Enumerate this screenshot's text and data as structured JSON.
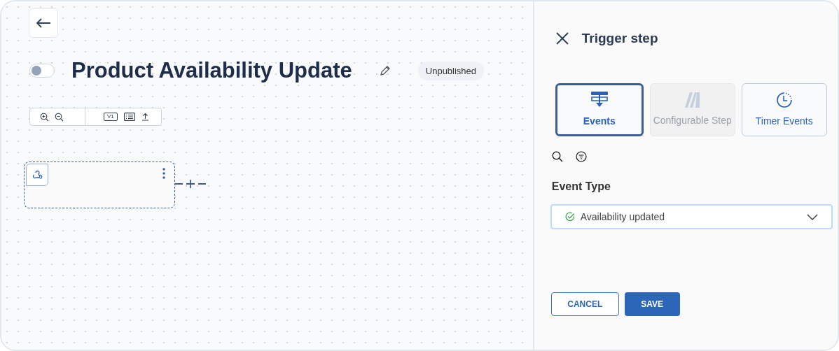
{
  "workflow": {
    "title": "Product Availability Update",
    "enabled": false,
    "status": "Unpublished",
    "version": "V1"
  },
  "panel": {
    "title": "Trigger step",
    "tabs": [
      {
        "label": "Events",
        "kind": "events",
        "selected": true,
        "disabled": false
      },
      {
        "label": "Configurable Step",
        "kind": "configurable",
        "selected": false,
        "disabled": true
      },
      {
        "label": "Timer Events",
        "kind": "timer",
        "selected": false,
        "disabled": false
      }
    ],
    "event_type": {
      "label": "Event Type",
      "value": "Availability updated",
      "focused": true
    },
    "buttons": [
      {
        "label": "CANCEL",
        "kind": "secondary"
      },
      {
        "label": "SAVE",
        "kind": "primary"
      }
    ]
  }
}
